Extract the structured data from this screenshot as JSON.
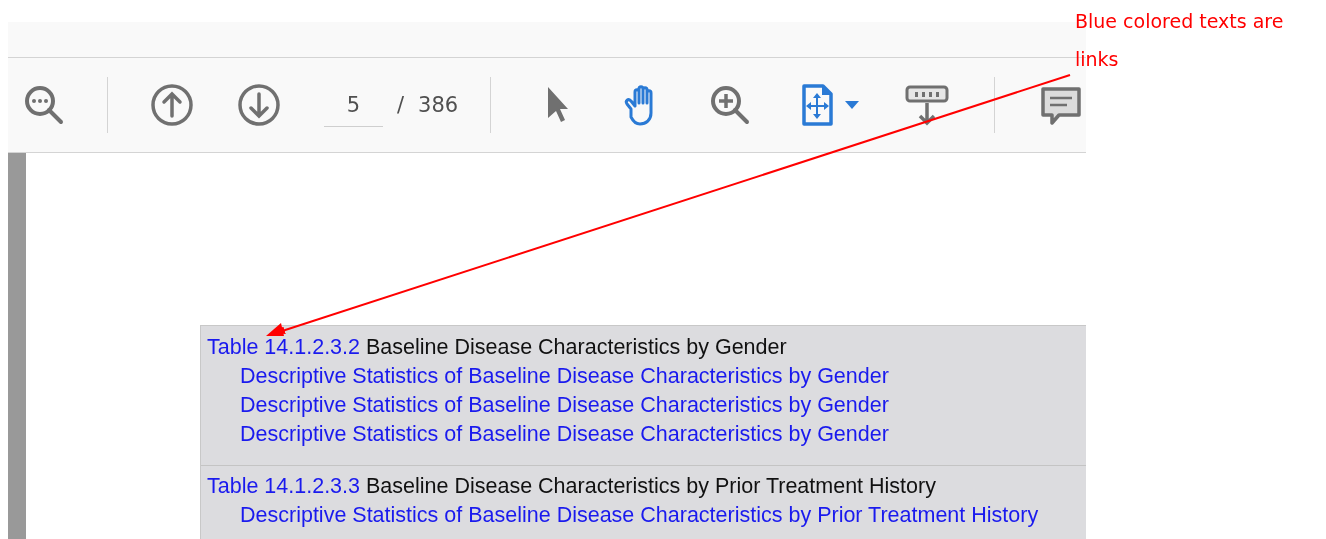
{
  "toolbar": {
    "page_number": "5",
    "page_separator": "/",
    "page_count": "386"
  },
  "toc": [
    {
      "table_link": "Table 14.1.2.3.2",
      "title": "Baseline Disease Characteristics by Gender",
      "links": [
        "Descriptive Statistics of Baseline Disease Characteristics by Gender",
        "Descriptive Statistics of Baseline Disease Characteristics by Gender",
        "Descriptive Statistics of Baseline Disease Characteristics by Gender"
      ]
    },
    {
      "table_link": "Table 14.1.2.3.3",
      "title": "Baseline Disease Characteristics by Prior Treatment History",
      "links": [
        "Descriptive Statistics of Baseline Disease Characteristics by Prior Treatment History"
      ]
    }
  ],
  "annotation": {
    "text": "Blue colored texts are links"
  }
}
